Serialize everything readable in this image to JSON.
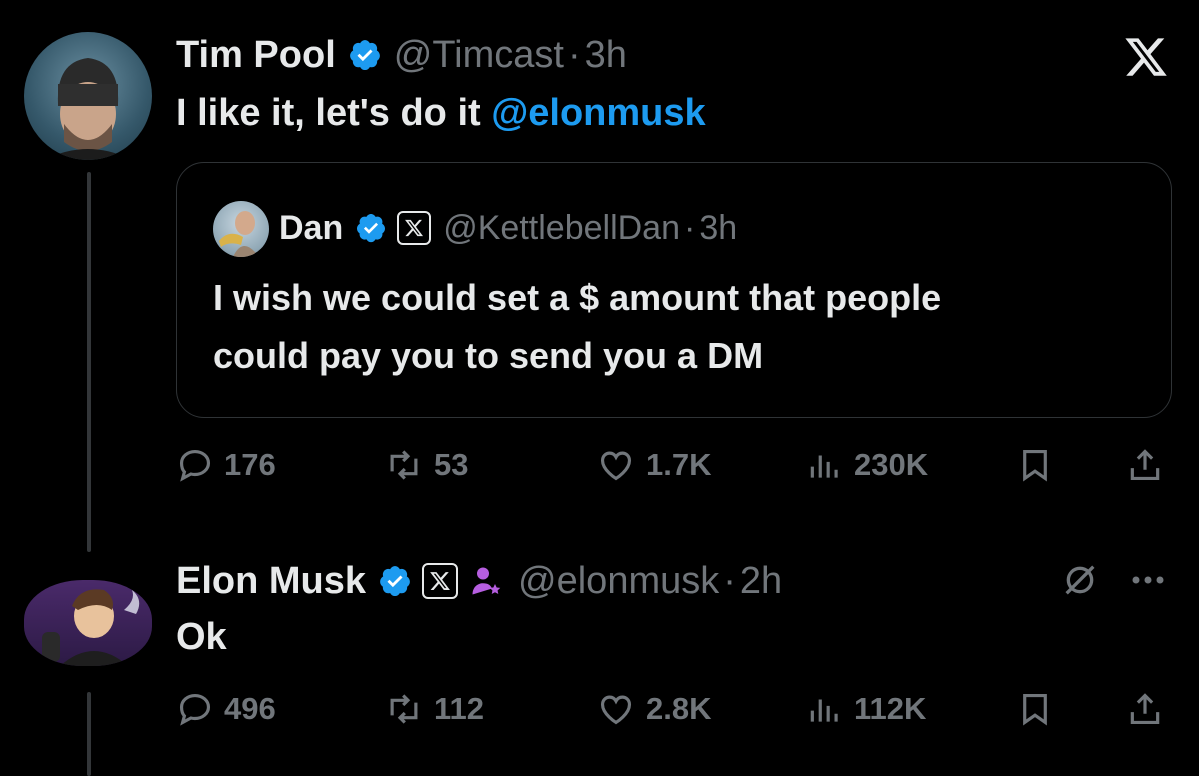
{
  "post1": {
    "author_name": "Tim Pool",
    "handle": "@Timcast",
    "separator": "·",
    "time": "3h",
    "text_prefix": "I like it, let's do it ",
    "mention": "@elonmusk",
    "quote": {
      "author_name": "Dan",
      "handle": "@KettlebellDan",
      "separator": "·",
      "time": "3h",
      "text_line1": "I wish we could set a $ amount that people",
      "text_line2": "could pay you to send you a DM"
    },
    "stats": {
      "replies": "176",
      "reposts": "53",
      "likes": "1.7K",
      "views": "230K"
    }
  },
  "post2": {
    "author_name": "Elon Musk",
    "handle": "@elonmusk",
    "separator": "·",
    "time": "2h",
    "text": "Ok",
    "stats": {
      "replies": "496",
      "reposts": "112",
      "likes": "2.8K",
      "views": "112K"
    }
  },
  "colors": {
    "accent": "#1d9bf0",
    "muted": "#71767b",
    "text": "#e7e9ea",
    "background": "#000000",
    "affiliate": "#b65ee0"
  },
  "icons": [
    "x-logo-icon",
    "verified-badge-icon",
    "reply-icon",
    "repost-icon",
    "like-icon",
    "views-icon",
    "bookmark-icon",
    "share-icon",
    "grok-icon",
    "more-icon",
    "affiliate-icon"
  ]
}
